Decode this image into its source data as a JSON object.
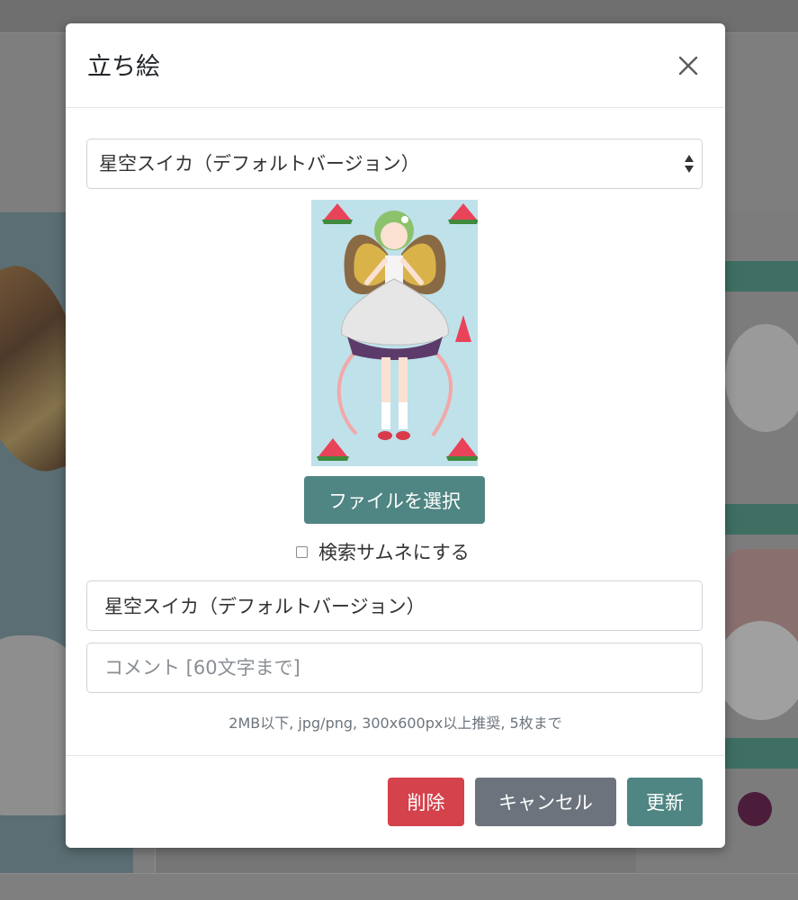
{
  "modal": {
    "title": "立ち絵",
    "close_icon": "close-icon",
    "select": {
      "selected_value": "星空スイカ（デフォルトバージョン）",
      "arrows_icon": "select-arrows-icon"
    },
    "preview": {
      "subject": "character-illustration"
    },
    "file_button_label": "ファイルを選択",
    "checkbox": {
      "label": "検索サムネにする",
      "checked": false
    },
    "name_field": {
      "value": "星空スイカ（デフォルトバージョン）"
    },
    "comment_field": {
      "value": "",
      "placeholder": "コメント [60文字まで]"
    },
    "hint": "2MB以下, jpg/png, 300x600px以上推奨, 5枚まで",
    "footer": {
      "delete_label": "削除",
      "cancel_label": "キャンセル",
      "update_label": "更新"
    }
  },
  "colors": {
    "primary_teal": "#4f8582",
    "danger_red": "#d4424b",
    "secondary_gray": "#6c737c",
    "overlay": "#7e7e7e"
  }
}
